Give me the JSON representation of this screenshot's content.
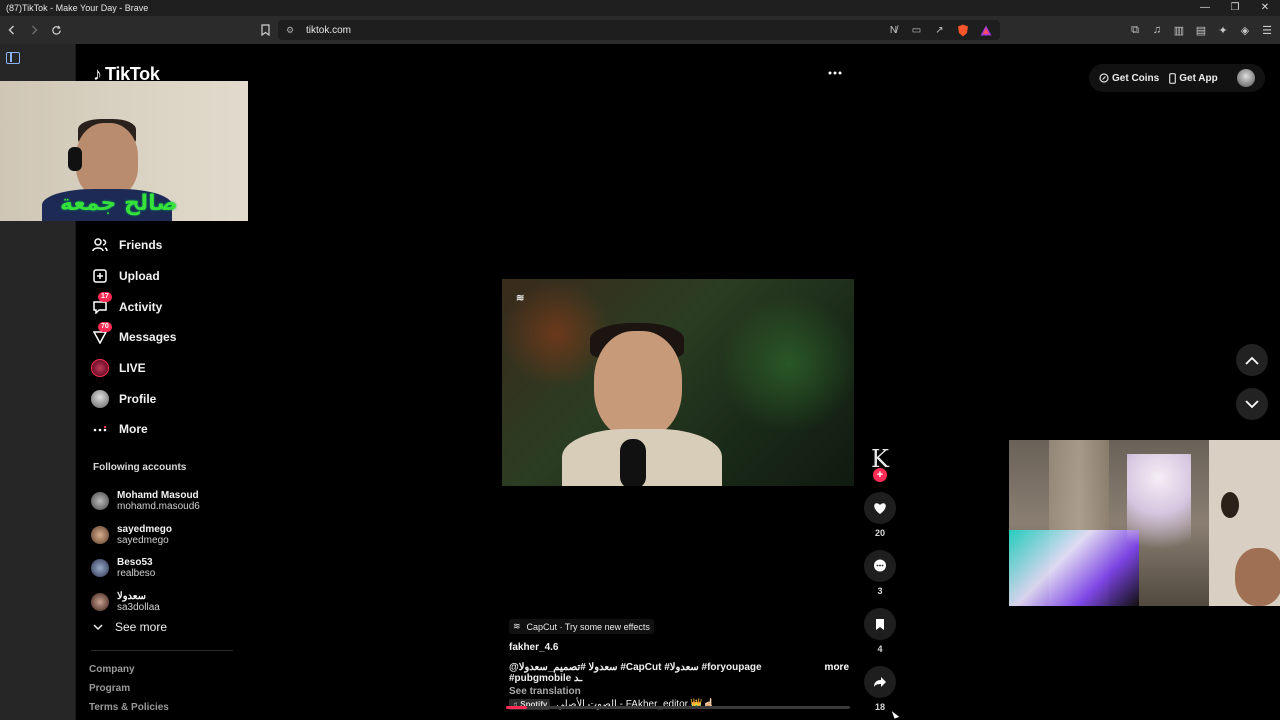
{
  "window": {
    "title": "(87)TikTok - Make Your Day - Brave",
    "controls": [
      "—",
      "❐",
      "✕"
    ]
  },
  "browser": {
    "url": "tiktok.com"
  },
  "tiktok": {
    "logo_text": "TikTok",
    "nav": [
      {
        "label": "Friends"
      },
      {
        "label": "Upload"
      },
      {
        "label": "Activity",
        "badge": "17"
      },
      {
        "label": "Messages",
        "badge": "70"
      },
      {
        "label": "LIVE"
      },
      {
        "label": "Profile"
      },
      {
        "label": "More"
      }
    ],
    "following_title": "Following accounts",
    "following": [
      {
        "name": "Mohamd Masoud",
        "handle": "mohamd.masoud6"
      },
      {
        "name": "sayedmego",
        "handle": "sayedmego"
      },
      {
        "name": "Beso53",
        "handle": "realbeso"
      },
      {
        "name": "سعدولا",
        "handle": "sa3dollaa"
      }
    ],
    "see_more": "See more",
    "footer_links": [
      "Company",
      "Program",
      "Terms & Policies"
    ],
    "header": {
      "get_coins": "Get Coins",
      "get_app": "Get App"
    },
    "video": {
      "capcut_tag": "CapCut · Try some new effects",
      "author": "fakher_4.6",
      "description": "@سعدولا #تصميم_سعدولا #CapCut #سعدولا #foryoupage #pubgmobile ـد",
      "more": "more",
      "see_translation": "See translation",
      "music_source": "Spotify",
      "music": "الصوت الأصلي - FAkher_editor.👑☝🏻",
      "progress_fraction": 0.06,
      "creator_initial": "K",
      "likes": "20",
      "comments": "3",
      "saves": "4",
      "shares": "18"
    }
  },
  "overlay": {
    "streamer_caption": "صالح جمعة"
  },
  "colors": {
    "accent": "#fe2c55",
    "background": "#000000",
    "sidebar_strip": "#262626",
    "caption_green": "#36e23a"
  }
}
